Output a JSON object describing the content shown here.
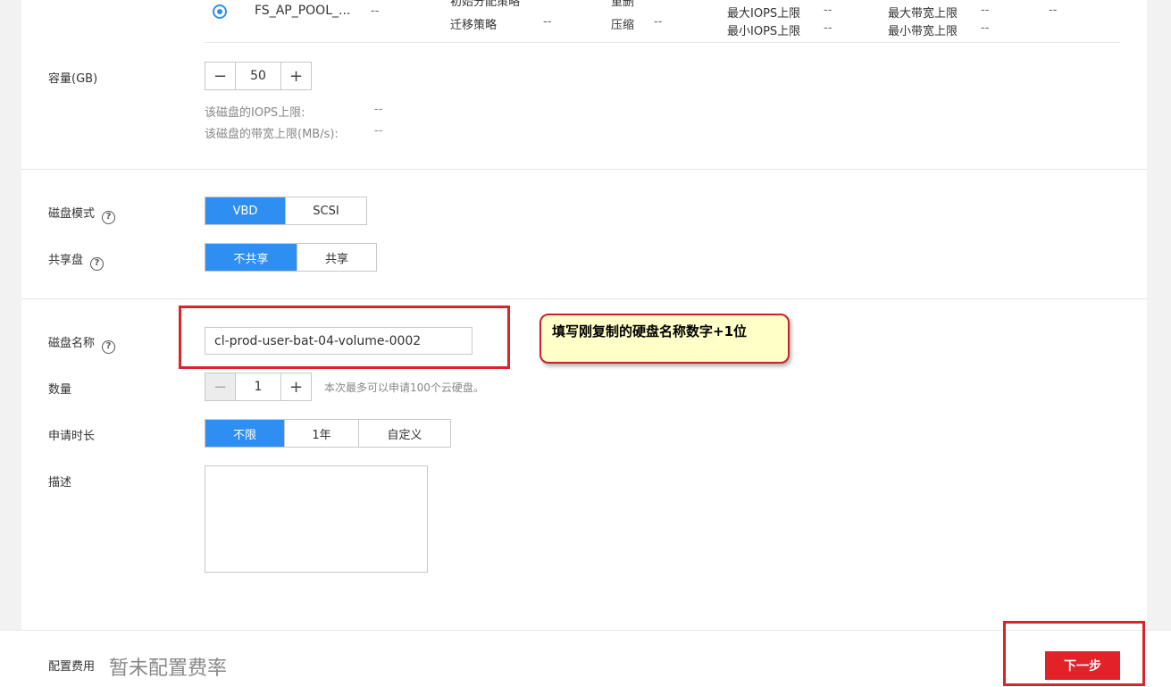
{
  "pool_table": {
    "row": {
      "pool_name": "FS_AP_POOL_...",
      "pool_value": "--",
      "col2_top_label": "初始分配策略",
      "col2_top_value": "--",
      "col2_label": "迁移策略",
      "col2_value": "--",
      "col3_top_label": "重删",
      "col3_top_value": "--",
      "col3_label": "压缩",
      "col3_value": "--",
      "max_iops_label": "最大IOPS上限",
      "max_iops_value": "--",
      "min_iops_label": "最小IOPS上限",
      "min_iops_value": "--",
      "max_bw_label": "最大带宽上限",
      "max_bw_value": "--",
      "min_bw_label": "最小带宽上限",
      "min_bw_value": "--",
      "last_value": "--"
    }
  },
  "capacity": {
    "label": "容量(GB)",
    "minus": "−",
    "value": "50",
    "plus": "+",
    "iops_label": "该磁盘的IOPS上限:",
    "iops_value": "--",
    "bw_label": "该磁盘的带宽上限(MB/s):",
    "bw_value": "--"
  },
  "disk_mode": {
    "label": "磁盘模式",
    "help": "?",
    "options": [
      "VBD",
      "SCSI"
    ],
    "selected": "VBD"
  },
  "shared_disk": {
    "label": "共享盘",
    "help": "?",
    "options": [
      "不共享",
      "共享"
    ],
    "selected": "不共享"
  },
  "disk_name": {
    "label": "磁盘名称",
    "help": "?",
    "value": "cl-prod-user-bat-04-volume-0002"
  },
  "annotation": {
    "text": "填写刚复制的硬盘名称数字+1位"
  },
  "quantity": {
    "label": "数量",
    "minus": "−",
    "value": "1",
    "plus": "+",
    "hint": "本次最多可以申请100个云硬盘。"
  },
  "duration": {
    "label": "申请时长",
    "options": [
      "不限",
      "1年",
      "自定义"
    ],
    "selected": "不限"
  },
  "description": {
    "label": "描述",
    "value": ""
  },
  "footer": {
    "fee_label": "配置费用",
    "fee_value": "暂未配置费率",
    "next_label": "下一步"
  },
  "colors": {
    "primary": "#2e8ef2",
    "danger": "#e22128",
    "annotation_bg": "#ffffc8"
  }
}
